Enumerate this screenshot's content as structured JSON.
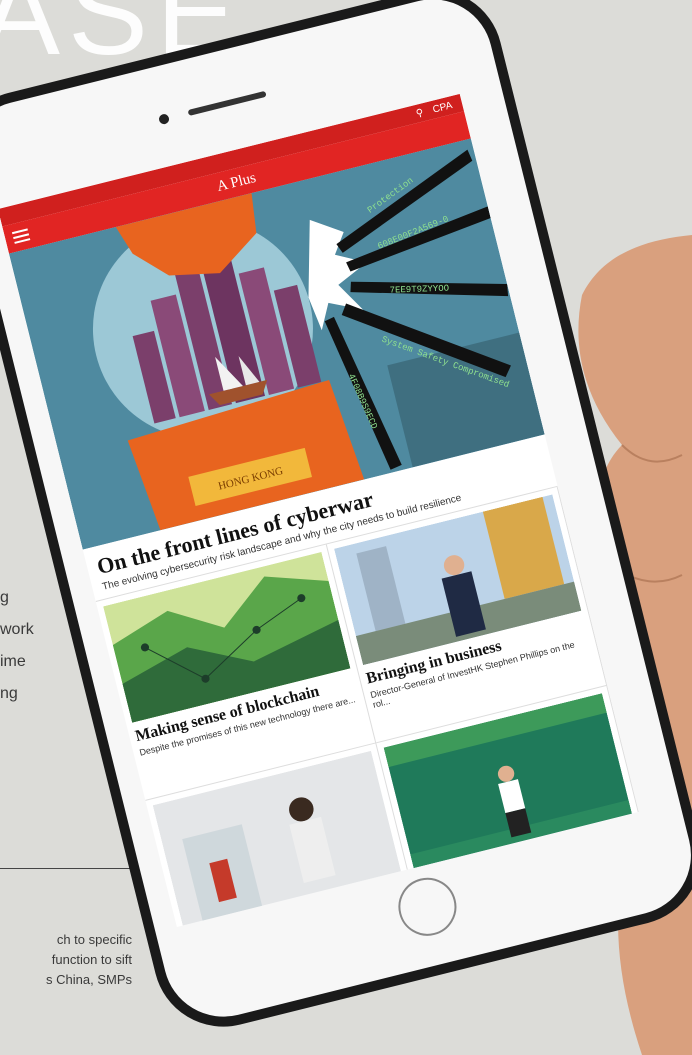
{
  "background": {
    "headline": "ASE",
    "body_lines": [
      "g",
      "work",
      "ime",
      "ng"
    ],
    "footer_lines": [
      "ch to specific",
      "function to sift",
      "s China, SMPs"
    ]
  },
  "app": {
    "title": "A Plus",
    "status_right": "CPA"
  },
  "hero": {
    "sign_text": "HONG KONG",
    "code_texts": [
      "Protection",
      "608E00F2A569-0",
      "7EE9T9ZYYOO",
      "System Safety Compromised",
      "4F08B9S9ECD"
    ],
    "title": "On the front lines of cyberwar",
    "subtitle": "The evolving cybersecurity risk landscape and why the city needs to build resilience"
  },
  "articles": [
    {
      "title": "Making sense of blockchain",
      "subtitle": "Despite the promises of this new technology there are..."
    },
    {
      "title": "Bringing in business",
      "subtitle": "Director-General of InvestHK Stephen Phillips on the rol..."
    }
  ],
  "colors": {
    "brand_red": "#e12523",
    "hero_bg": "#4f8aa0",
    "orange": "#e8641f"
  }
}
